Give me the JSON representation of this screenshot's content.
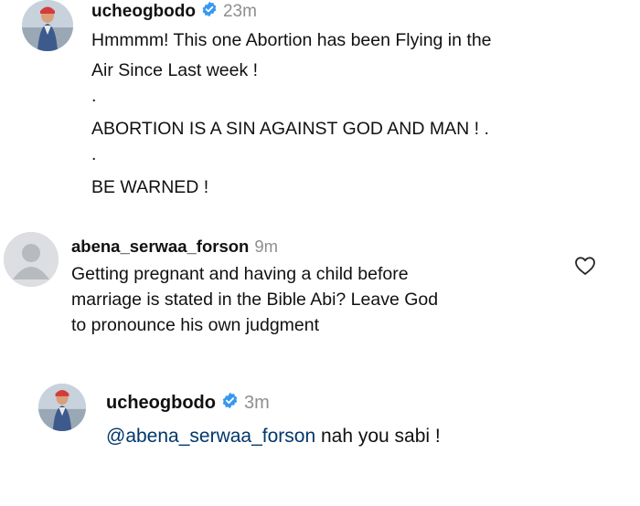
{
  "comments": [
    {
      "username": "ucheogbodo",
      "verified": true,
      "time": "23m",
      "lines": [
        "Hmmmm! This one Abortion has been Flying in the",
        "Air Since Last week !",
        ".",
        "ABORTION IS A SIN AGAINST GOD AND MAN ! .",
        ".",
        "BE WARNED !"
      ]
    },
    {
      "username": "abena_serwaa_forson",
      "verified": false,
      "time": "9m",
      "lines": [
        "Getting pregnant and having a child before",
        "marriage is stated in the Bible Abi?  Leave God",
        "to pronounce his own judgment"
      ],
      "like_icon": "heart-outline-icon"
    },
    {
      "username": "ucheogbodo",
      "verified": true,
      "time": "3m",
      "mention": "@abena_serwaa_forson",
      "reply_text": " nah you sabi !"
    }
  ],
  "colors": {
    "verified_badge": "#3897f0",
    "mention": "#00376b",
    "timestamp": "#8e8e8e"
  }
}
